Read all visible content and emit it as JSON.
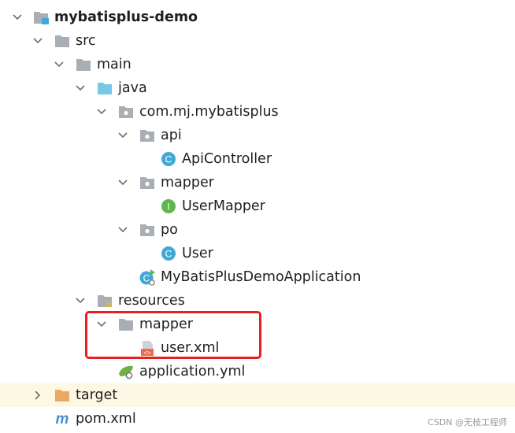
{
  "tree": {
    "project": {
      "name": "mybatisplus-demo"
    },
    "src": "src",
    "main": "main",
    "java": "java",
    "package": "com.mj.mybatisplus",
    "api_pkg": "api",
    "api_controller": "ApiController",
    "mapper_pkg": "mapper",
    "user_mapper": "UserMapper",
    "po_pkg": "po",
    "user_class": "User",
    "app_class": "MyBatisPlusDemoApplication",
    "resources": "resources",
    "res_mapper": "mapper",
    "user_xml": "user.xml",
    "app_yml": "application.yml",
    "target": "target",
    "pom": "pom.xml"
  },
  "icons": {
    "class_badge": "C",
    "interface_badge": "I",
    "maven": "m",
    "xml_badge": "<>"
  },
  "colors": {
    "folder": "#a9aeb5",
    "source_folder": "#78c8e8",
    "target_folder": "#f0a561",
    "class": "#40a8d6",
    "interface": "#5fb84b",
    "highlight_border": "#e8201d",
    "target_row_bg": "#fdf8e4"
  },
  "watermark": "CSDN @无枝工程师"
}
